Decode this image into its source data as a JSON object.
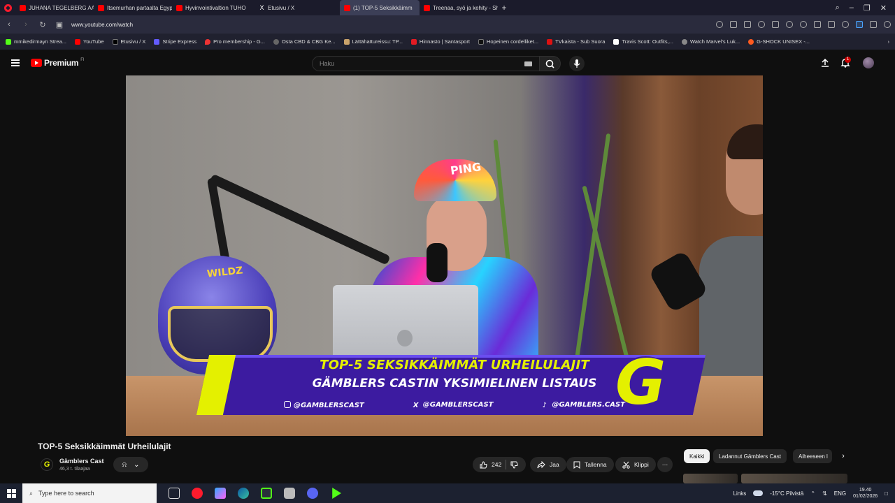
{
  "browser": {
    "tabs": [
      {
        "label": "JUHANA TEGELBERG AASI",
        "icon": "youtube-icon",
        "active": false
      },
      {
        "label": "Itsemurhan partaalta Egypt",
        "icon": "youtube-icon",
        "active": false
      },
      {
        "label": "Hyvinvointivaltion TUHO",
        "icon": "youtube-icon",
        "active": false
      },
      {
        "label": "Etusivu / X",
        "icon": "x-icon",
        "active": false
      },
      {
        "label": "(1) TOP-5 Seksikkäimm",
        "icon": "youtube-icon",
        "active": true
      },
      {
        "label": "Treenaa, syö ja kehity - Sh",
        "icon": "youtube-icon",
        "active": false
      }
    ],
    "new_tab": "+",
    "url": "www.youtube.com/watch",
    "bookmarks": [
      "mmikedirmayn Strea...",
      "YouTube",
      "Etusivu / X",
      "Stripe Express",
      "Pro membership - G...",
      "Osta CBD & CBG Ke...",
      "Lättähattureissu: TP...",
      "Hinnasto | Santasport",
      "Hopeinen cordelliket...",
      "TVkaista - Sub Suora",
      "Travis Scott: Outfits,...",
      "Watch Marvel's Luk...",
      "G-SHOCK UNISEX -..."
    ]
  },
  "youtube": {
    "logo_text": "Premium",
    "logo_region": "FI",
    "search_placeholder": "Haku",
    "notification_count": "1",
    "video": {
      "banner_line1": "TOP-5 SEKSIKKÄIMMÄT URHEILULAJIT",
      "banner_line2": "GÄMBLERS CASTIN YKSIMIELINEN LISTAUS",
      "social": [
        "@GAMBLERSCAST",
        "@GAMBLERSCAST",
        "@GAMBLERS.CAST"
      ],
      "helmet_logo": "WILDZ",
      "cap_text": "PING",
      "channel_logo": "G"
    },
    "title": "TOP-5 Seksikkäimmät Urheilulajit",
    "channel": {
      "name": "Gämblers Cast",
      "subscribers": "46,3 t. tilaajaa",
      "avatar_letter": "G"
    },
    "actions": {
      "like_count": "242",
      "share": "Jaa",
      "save": "Tallenna",
      "clip": "Klippi",
      "more": "⋯"
    },
    "chips": [
      "Kaikki",
      "Ladannut Gämblers Cast",
      "Aiheeseen l"
    ]
  },
  "taskbar": {
    "search_placeholder": "Type here to search",
    "links": "Links",
    "weather": "-15°C Pilvistä",
    "language": "ENG",
    "time": "19.40",
    "date": "01/02/2026"
  }
}
